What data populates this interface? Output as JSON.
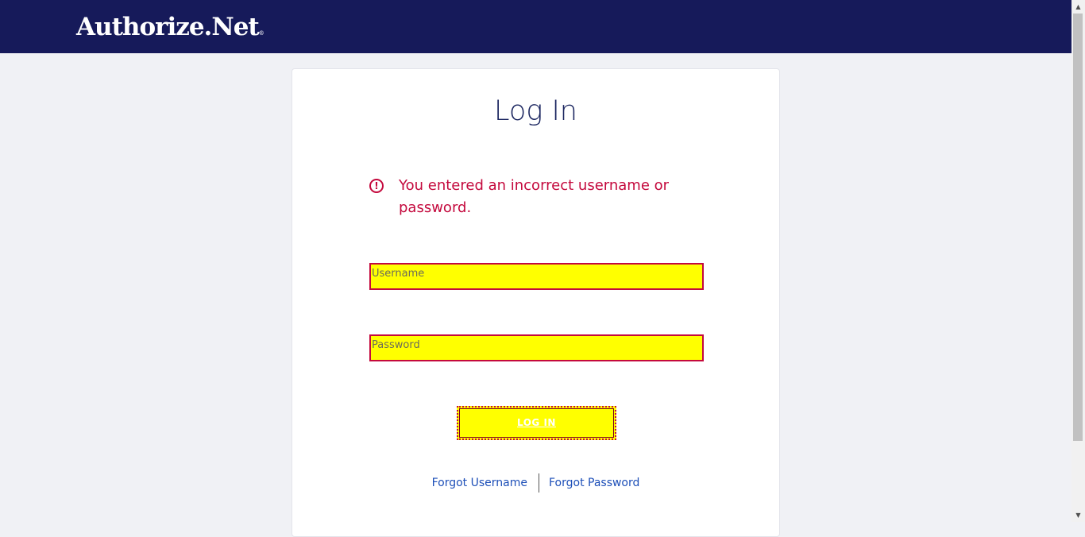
{
  "header": {
    "logo_text": "Authorize.Net",
    "logo_reg": "®",
    "background_color": "#161a5a"
  },
  "login": {
    "title": "Log In",
    "error_icon": "!",
    "error_message": "You entered an incorrect username or password.",
    "username_placeholder": "Username",
    "username_value": "",
    "password_placeholder": "Password",
    "password_value": "",
    "submit_label": "LOG IN",
    "forgot_username": "Forgot Username",
    "forgot_password": "Forgot Password"
  },
  "colors": {
    "error": "#c4093d",
    "field_highlight": "#ffff00",
    "link": "#1d4fb8",
    "title": "#1b2660"
  },
  "scrollbar": {
    "up_arrow": "▲",
    "down_arrow": "▼"
  }
}
